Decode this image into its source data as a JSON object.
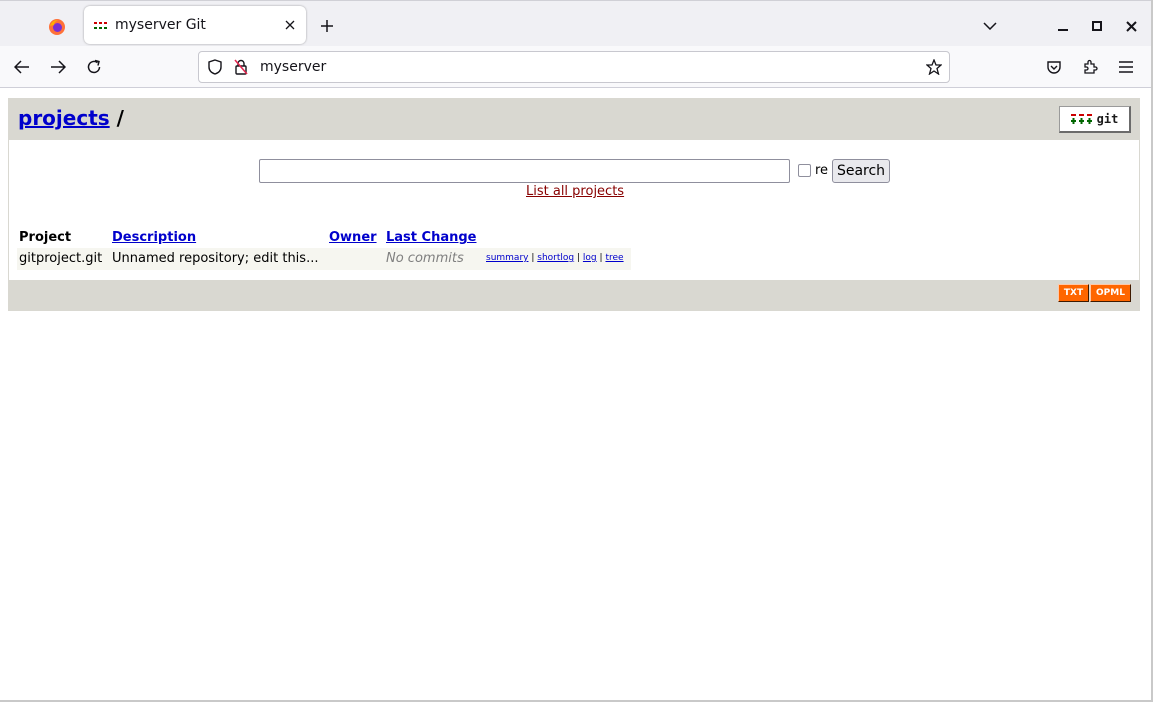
{
  "browser": {
    "tab_title": "myserver Git",
    "url": "myserver"
  },
  "colors": {
    "header_bg": "#d9d8d1",
    "link": "#0000cc",
    "list_all_link": "#880000",
    "feed_button": "#ff6600"
  },
  "icons": {
    "tabstrip": [
      "firefox-icon",
      "gitweb-favicon",
      "close-icon",
      "plus-icon",
      "chevron-down-icon",
      "minimize-icon",
      "maximize-icon",
      "close-window-icon"
    ],
    "navbar": [
      "back-arrow-icon",
      "forward-arrow-icon",
      "reload-icon",
      "shield-icon",
      "insecure-lock-icon",
      "bookmark-star-icon",
      "pocket-icon",
      "extensions-icon",
      "hamburger-menu-icon"
    ]
  },
  "header": {
    "projects_link": "projects",
    "separator": "/"
  },
  "search": {
    "input_value": "",
    "re_label": "re",
    "re_checked": false,
    "button_label": "Search",
    "list_all_link": "List all projects"
  },
  "table": {
    "headers": {
      "project": "Project",
      "description": "Description",
      "owner": "Owner",
      "last_change": "Last Change"
    },
    "rows": [
      {
        "project": "gitproject.git",
        "description": "Unnamed repository; edit this...",
        "owner": "",
        "last_change": "No commits",
        "links": {
          "summary": "summary",
          "shortlog": "shortlog",
          "log": "log",
          "tree": "tree",
          "separator": "|"
        }
      }
    ]
  },
  "footer": {
    "txt_button": "TXT",
    "opml_button": "OPML"
  },
  "logo": {
    "text": "git"
  }
}
